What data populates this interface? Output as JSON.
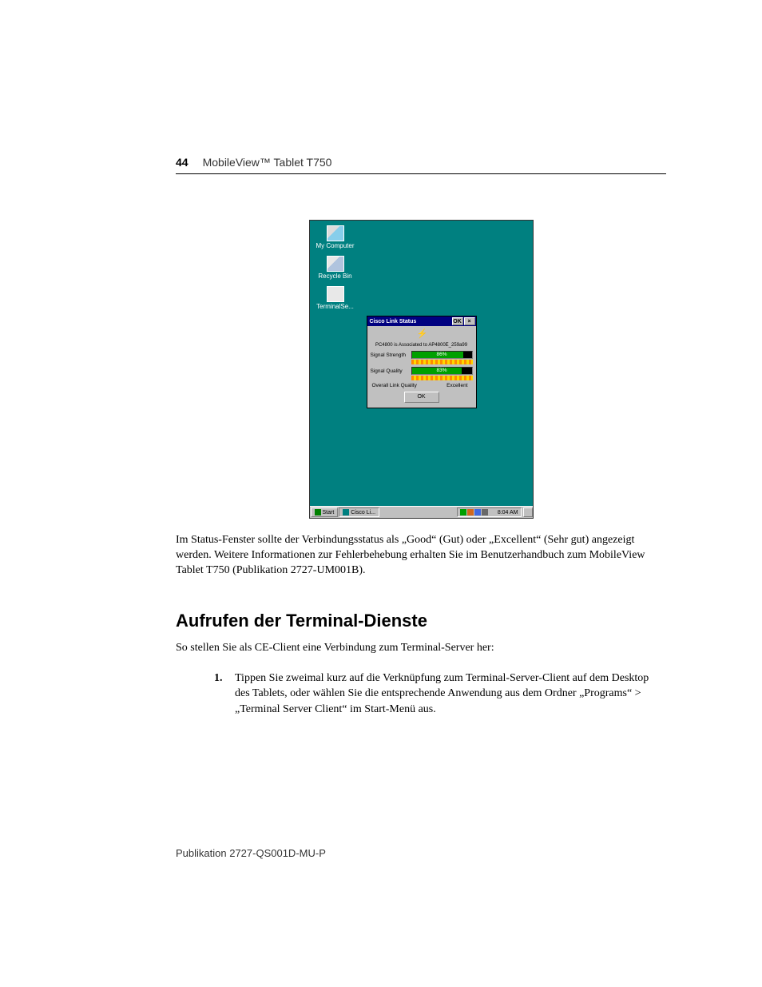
{
  "header": {
    "page_number": "44",
    "title": "MobileView™ Tablet T750"
  },
  "desktop": {
    "icons": [
      {
        "label": "My Computer"
      },
      {
        "label": "Recycle Bin"
      },
      {
        "label": "TerminalSe..."
      }
    ],
    "dialog": {
      "title": "Cisco Link Status",
      "ok_caption": "OK",
      "close_caption": "×",
      "association": "PC4800 is Associated to AP4800E_259a99",
      "signal_strength_label": "Signal Strength",
      "signal_strength_pct": "86%",
      "signal_quality_label": "Signal Quality",
      "signal_quality_pct": "83%",
      "overall_label": "Overall Link Quality",
      "overall_value": "Excellent",
      "ok_button": "OK"
    },
    "taskbar": {
      "start": "Start",
      "task": "Cisco Li...",
      "clock": "8:04 AM"
    }
  },
  "body": {
    "p1": "Im Status-Fenster sollte der Verbindungsstatus als „Good“ (Gut) oder „Excellent“ (Sehr gut) angezeigt werden. Weitere Informationen zur Fehlerbehebung erhalten Sie im Benutzerhandbuch zum MobileView Tablet T750 (Publikation 2727-UM001B).",
    "h2": "Aufrufen der Terminal-Dienste",
    "p2": "So stellen Sie als CE-Client eine Verbindung zum Terminal-Server her:",
    "step1_num": "1.",
    "step1_text": "Tippen Sie zweimal kurz auf die Verknüpfung zum Terminal-Server-Client auf dem Desktop des Tablets, oder wählen Sie die entsprechende Anwendung aus dem Ordner „Programs“ > „Terminal Server Client“ im Start-Menü aus."
  },
  "footer": "Publikation 2727-QS001D-MU-P"
}
